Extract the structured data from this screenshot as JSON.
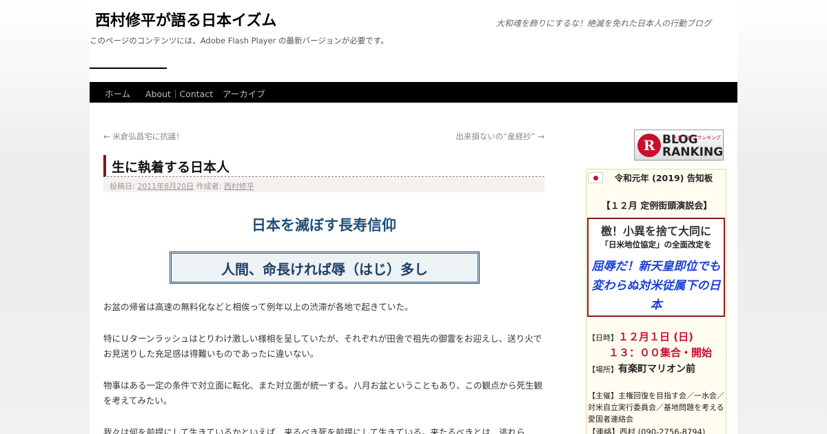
{
  "header": {
    "site_title": "西村修平が語る日本イズム",
    "site_description": "大和魂を飾りにするな！絶滅を免れた日本人の行動ブログ",
    "flash_notice": "このページのコンテンツには、Adobe Flash Player の最新バージョンが必要です。"
  },
  "nav": {
    "items": [
      {
        "label": "ホーム"
      },
      {
        "label": "About｜Contact"
      },
      {
        "label": "アーカイブ"
      }
    ]
  },
  "post_nav": {
    "prev": "← 米倉弘昌宅に抗議！",
    "next": "出来損ないの“産経抄” →"
  },
  "post": {
    "title": "生に執着する日本人",
    "meta_posted_label": "投稿日:",
    "meta_date": "2011年8月20日",
    "meta_author_label": "作成者:",
    "meta_author": "西村修平",
    "headline": "日本を滅ぼす長寿信仰",
    "boxed_quote": "人間、命長ければ辱（はじ）多し",
    "paragraphs": [
      "お盆の帰省は高速の無料化などと相俟って例年以上の渋滞が各地で起きていた。",
      "特にＵターンラッシュはとりわけ激しい様相を呈していたが、それぞれが田舎で祖先の御霊をお迎えし、送り火でお見送りした充足感は得難いものであったに違いない。",
      "物事はある一定の条件で対立面に転化、また対立面が統一する。八月お盆ということもあり、この観点から死生観を考えてみたい。",
      "我々は何を前提にして生きているかといえば、来るべき死を前提にして生きている。来たるべきとは、逃れら"
    ]
  },
  "sidebar": {
    "blog_ranking": {
      "logo_letter": "R",
      "line1": "BLOG",
      "line2": "RANKING",
      "small_text": "人気ブログランキング"
    },
    "notice": {
      "title": "令和元年 (2019) 告知板",
      "event_name": "【１２月 定例街頭演説会】",
      "red_box_line1": "檄！小異を捨て大同に",
      "red_box_line2": "「日米地位協定」の全面改定を",
      "red_box_line3": "屈辱だ！新天皇即位でも変わらぬ対米従属下の日本",
      "date_label": "【日時】",
      "date_value": "１２月１日 (日)",
      "time_value": "１３：００集合・開始",
      "place_label": "【場所】",
      "place_value": "有楽町マリオン前",
      "organizers": "【主催】主権回復を目指す会／一水会／対米自立実行委員会／基地問題を考える愛国者連絡会",
      "contact": "【連絡】西村 (090-2756-8794)"
    }
  },
  "colors": {
    "nav_bg": "#000000",
    "title_accent": "#7a1c1c",
    "headline": "#1f4e79",
    "notice_red": "#c8102e",
    "notice_blue": "#1a3fd6"
  }
}
